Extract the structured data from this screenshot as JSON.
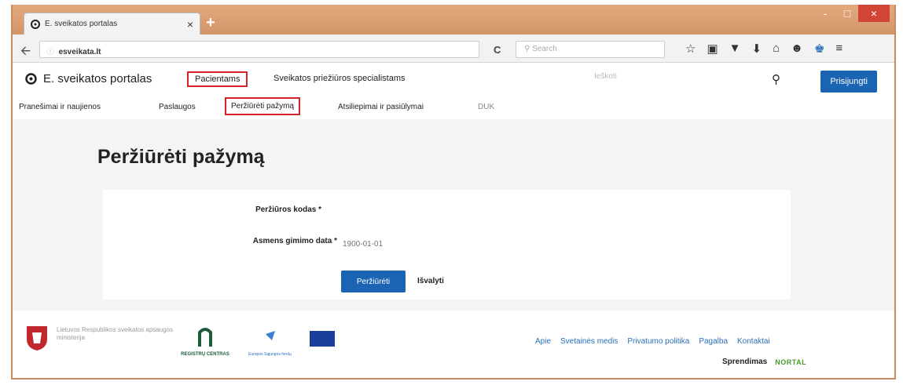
{
  "browser": {
    "tab_title": "E. sveikatos portalas",
    "tab_close": "×",
    "new_tab": "+",
    "url_domain": "esveikata.lt",
    "search_placeholder": "Search",
    "window_buttons": [
      "-",
      "□",
      "×"
    ]
  },
  "site": {
    "logo_text": "E. sveikatos portalas",
    "top_nav": [
      {
        "label": "Pacientams",
        "selected": true
      },
      {
        "label": "Sveikatos priežiūros specialistams",
        "selected": false
      }
    ],
    "search_placeholder": "Ieškoti",
    "login_label": "Prisijungti"
  },
  "subnav": [
    {
      "label": "Pranešimai ir naujienos"
    },
    {
      "label": "Paslaugos"
    },
    {
      "label": "Peržiūrėti pažymą",
      "selected": true
    },
    {
      "label": "Atsiliepimai ir pasiūlymai"
    },
    {
      "label": "DUK"
    }
  ],
  "page": {
    "title": "Peržiūrėti pažymą",
    "fields": [
      {
        "label": "Peržiūros kodas *",
        "value": "",
        "placeholder": ""
      },
      {
        "label": "Asmens gimimo data *",
        "value": "",
        "placeholder": "1900-01-01"
      }
    ],
    "submit_label": "Peržiūrėti",
    "clear_label": "Išvalyti"
  },
  "footer": {
    "ministry": "Lietuvos Respublikos sveikatos apsaugos ministerija",
    "hub_caption": "REGISTRŲ CENTRAS",
    "eu_caption": "Europos Sąjungos fondų",
    "links": [
      "Apie",
      "Svetainės medis",
      "Privatumo politika",
      "Pagalba",
      "Kontaktai"
    ],
    "credit_label": "Sprendimas",
    "credit_brand": "NORTAL"
  },
  "colors": {
    "primary": "#1b64b4",
    "highlight": "#d4222b",
    "frame": "#c98a5e",
    "link": "#2a6ebb"
  }
}
